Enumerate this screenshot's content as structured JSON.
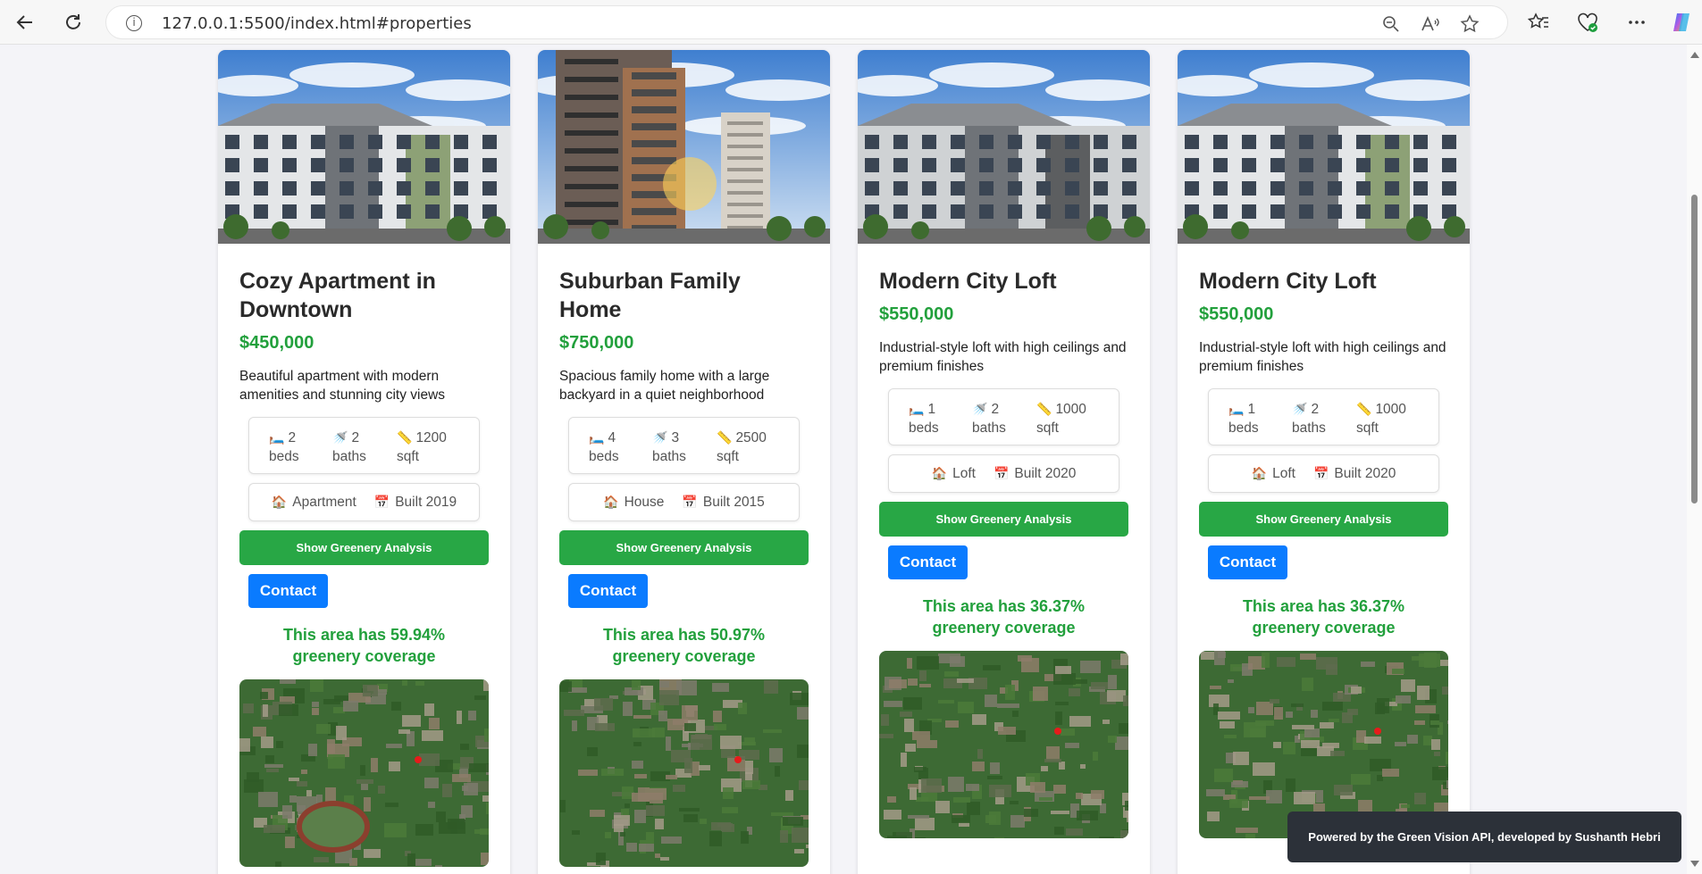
{
  "browser": {
    "url": "127.0.0.1:5500/index.html#properties"
  },
  "properties": [
    {
      "title": "Cozy Apartment in Downtown",
      "price": "$450,000",
      "description": "Beautiful apartment with modern amenities and stunning city views",
      "beds": "2",
      "beds_label": "beds",
      "baths": "2",
      "baths_label": "baths",
      "sqft": "1200",
      "sqft_label": "sqft",
      "type": "Apartment",
      "built": "Built 2019",
      "greenery_button": "Show Greenery Analysis",
      "contact_button": "Contact",
      "greenery_text": "This area has 59.94% greenery coverage"
    },
    {
      "title": "Suburban Family Home",
      "price": "$750,000",
      "description": "Spacious family home with a large backyard in a quiet neighborhood",
      "beds": "4",
      "beds_label": "beds",
      "baths": "3",
      "baths_label": "baths",
      "sqft": "2500",
      "sqft_label": "sqft",
      "type": "House",
      "built": "Built 2015",
      "greenery_button": "Show Greenery Analysis",
      "contact_button": "Contact",
      "greenery_text": "This area has 50.97% greenery coverage"
    },
    {
      "title": "Modern City Loft",
      "price": "$550,000",
      "description": "Industrial-style loft with high ceilings and premium finishes",
      "beds": "1",
      "beds_label": "beds",
      "baths": "2",
      "baths_label": "baths",
      "sqft": "1000",
      "sqft_label": "sqft",
      "type": "Loft",
      "built": "Built 2020",
      "greenery_button": "Show Greenery Analysis",
      "contact_button": "Contact",
      "greenery_text": "This area has 36.37% greenery coverage"
    },
    {
      "title": "Modern City Loft",
      "price": "$550,000",
      "description": "Industrial-style loft with high ceilings and premium finishes",
      "beds": "1",
      "beds_label": "beds",
      "baths": "2",
      "baths_label": "baths",
      "sqft": "1000",
      "sqft_label": "sqft",
      "type": "Loft",
      "built": "Built 2020",
      "greenery_button": "Show Greenery Analysis",
      "contact_button": "Contact",
      "greenery_text": "This area has 36.37% greenery coverage"
    }
  ],
  "footer": {
    "credit": "Powered by the Green Vision API, developed by Sushanth Hebri"
  },
  "colors": {
    "price_green": "#22a03c",
    "button_green": "#28a745",
    "contact_blue": "#0a7bff",
    "credit_bg": "#2c3139"
  },
  "icons": {
    "beds": "bed-icon",
    "baths": "shower-icon",
    "sqft": "ruler-icon",
    "type": "house-icon",
    "built": "calendar-icon"
  }
}
